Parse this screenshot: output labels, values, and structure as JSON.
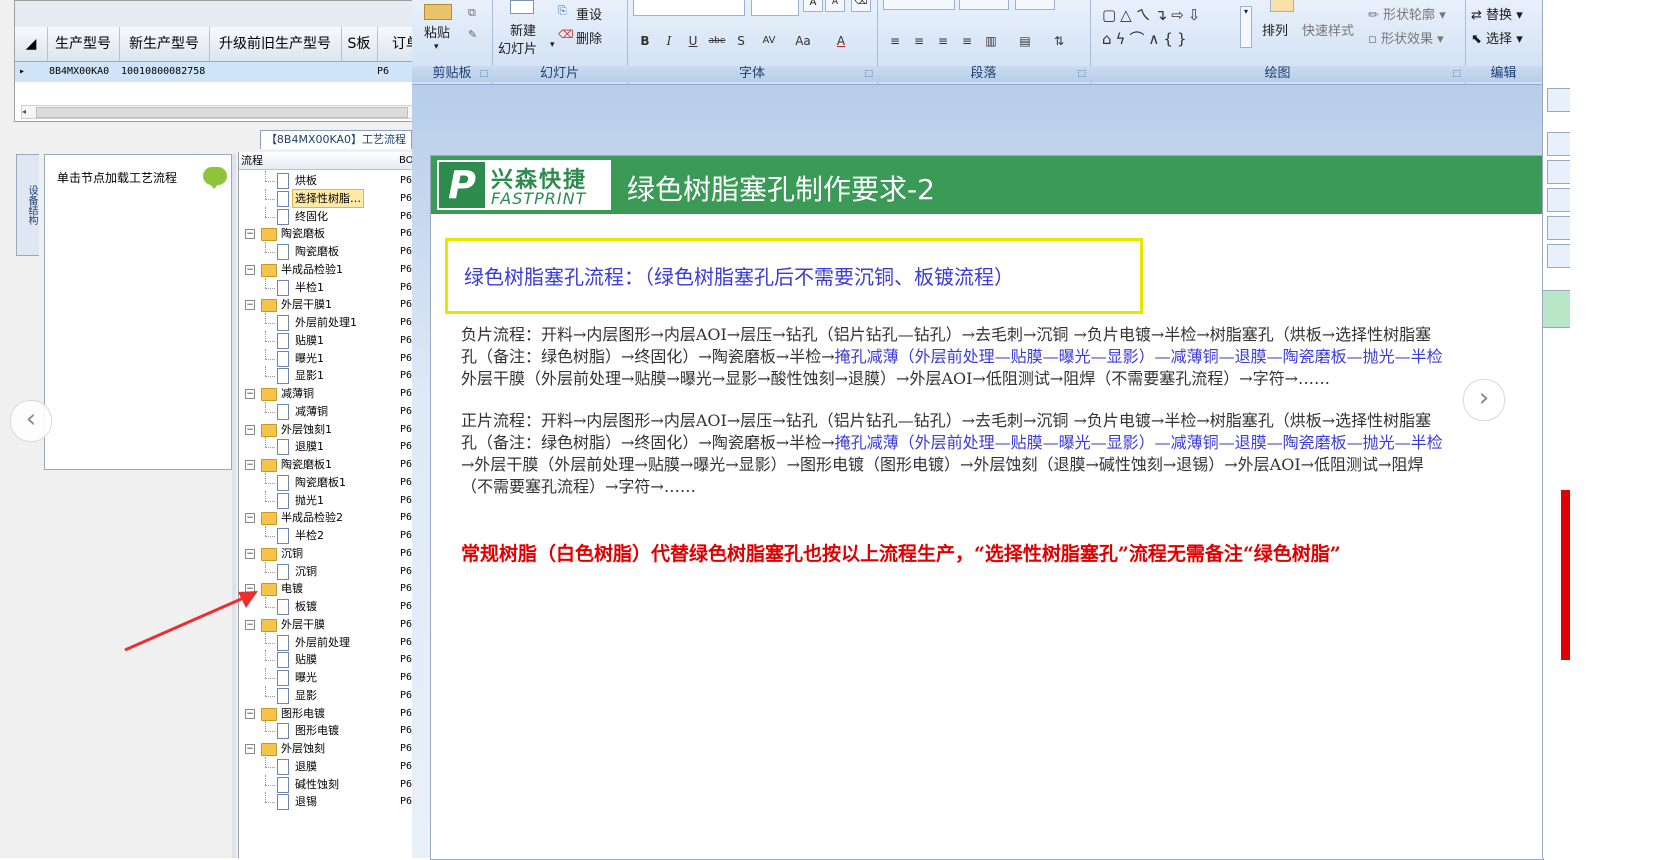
{
  "grid": {
    "columns": [
      "生产型号",
      "新生产型号",
      "升级前旧生产型号",
      "S板",
      "订单"
    ],
    "row": {
      "pointer": "▸",
      "c1": "8B4MX00KA0",
      "c2": "10010800082758",
      "c4": "P6"
    }
  },
  "tree_caption": "【8B4MX00KA0】工艺流程",
  "side_tab": "设备结构",
  "left_panel_text": "单击节点加载工艺流程",
  "tree": {
    "header_left": "流程",
    "header_right": "BOM工",
    "rows": [
      {
        "label": "烘板",
        "code": "P6"
      },
      {
        "label": "选择性树脂…",
        "code": "P6"
      },
      {
        "label": "终固化",
        "code": "P6"
      },
      {
        "label": "陶瓷磨板",
        "code": "P6"
      },
      {
        "label": "陶瓷磨板",
        "code": "P6"
      },
      {
        "label": "半成品检验1",
        "code": "P6"
      },
      {
        "label": "半检1",
        "code": "P6"
      },
      {
        "label": "外层干膜1",
        "code": "P6"
      },
      {
        "label": "外层前处理1",
        "code": "P6"
      },
      {
        "label": "贴膜1",
        "code": "P6"
      },
      {
        "label": "曝光1",
        "code": "P6"
      },
      {
        "label": "显影1",
        "code": "P6"
      },
      {
        "label": "减薄铜",
        "code": "P6"
      },
      {
        "label": "减薄铜",
        "code": "P6"
      },
      {
        "label": "外层蚀刻1",
        "code": "P6"
      },
      {
        "label": "退膜1",
        "code": "P6"
      },
      {
        "label": "陶瓷磨板1",
        "code": "P6"
      },
      {
        "label": "陶瓷磨板1",
        "code": "P6"
      },
      {
        "label": "抛光1",
        "code": "P6"
      },
      {
        "label": "半成品检验2",
        "code": "P6"
      },
      {
        "label": "半检2",
        "code": "P6"
      },
      {
        "label": "沉铜",
        "code": "P6"
      },
      {
        "label": "沉铜",
        "code": "P6"
      },
      {
        "label": "电镀",
        "code": "P6"
      },
      {
        "label": "板镀",
        "code": "P6"
      },
      {
        "label": "外层干膜",
        "code": "P6"
      },
      {
        "label": "外层前处理",
        "code": "P6"
      },
      {
        "label": "贴膜",
        "code": "P6"
      },
      {
        "label": "曝光",
        "code": "P6"
      },
      {
        "label": "显影",
        "code": "P6"
      },
      {
        "label": "图形电镀",
        "code": "P6"
      },
      {
        "label": "图形电镀",
        "code": "P6"
      },
      {
        "label": "外层蚀刻",
        "code": "P6"
      },
      {
        "label": "退膜",
        "code": "P6"
      },
      {
        "label": "碱性蚀刻",
        "code": "P6"
      },
      {
        "label": "退锡",
        "code": "P6"
      }
    ]
  },
  "ribbon": {
    "groups": [
      "剪贴板",
      "幻灯片",
      "字体",
      "段落",
      "绘图",
      "编辑"
    ],
    "paste": "粘贴",
    "new_slide_1": "新建",
    "new_slide_2": "幻灯片",
    "reset": "重设",
    "delete": "删除",
    "arrange": "排列",
    "quick_styles": "快速样式",
    "shape_outline": "形状轮廓",
    "shape_effects": "形状效果",
    "replace": "替换",
    "select": "选择",
    "font_buttons": [
      "B",
      "I",
      "U",
      "abe",
      "S",
      "AV",
      "Aa",
      "A"
    ]
  },
  "slide": {
    "logo_cn": "兴森快捷",
    "logo_en": "FASTPRINT",
    "logo_mark": "P",
    "title": "绿色树脂塞孔制作要求-2",
    "highlight": "绿色树脂塞孔流程：（绿色树脂塞孔后不需要沉铜、板镀流程）",
    "neg_line1_a": "负片流程：开料→内层图形→内层AOI→层压→钻孔（铝片钻孔—钻孔）→去毛刺→沉铜 →负片电镀→半检→树脂塞孔（烘板→选择性树脂塞",
    "neg_line2_a": "孔（备注：绿色树脂）→终固化）→陶瓷磨板→半检→",
    "neg_line2_b": "掩孔减薄（外层前处理—贴膜—曝光—显影）—减薄铜—退膜—陶瓷磨板—抛光—半检",
    "neg_line3_a": "外层干膜（外层前处理→贴膜→曝光→显影→酸性蚀刻→退膜）→外层AOI→低阻测试→阻焊（不需要塞孔流程）→字符→……",
    "pos_line1_a": "正片流程：开料→内层图形→内层AOI→层压→钻孔（铝片钻孔—钻孔）→去毛刺→沉铜 →负片电镀→半检→树脂塞孔（烘板→选择性树脂塞",
    "pos_line2_a": "孔（备注：绿色树脂）→终固化）→陶瓷磨板→半检→",
    "pos_line2_b": "掩孔减薄（外层前处理—贴膜—曝光—显影）—减薄铜—退膜—陶瓷磨板—抛光—半检",
    "pos_line3_a": "→外层干膜（外层前处理→贴膜→曝光→显影）→图形电镀（图形电镀）→外层蚀刻（退膜→碱性蚀刻→退锡）→外层AOI→低阻测试→阻焊",
    "pos_line4_a": "（不需要塞孔流程）→字符→……",
    "note": "常规树脂（白色树脂）代替绿色树脂塞孔也按以上流程生产，“选择性树脂塞孔”流程无需备注“绿色树脂”",
    "prev": "‹",
    "next": "›"
  },
  "colors": {
    "title_green": "#3a9a56",
    "highlight_border": "#e6e600",
    "blue_text": "#3b3bd6",
    "red_text": "#e00000",
    "arrow": "#e83030"
  }
}
